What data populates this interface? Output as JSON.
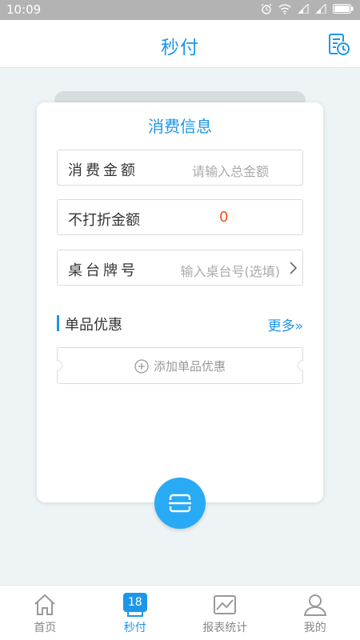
{
  "status_bar": {
    "time": "10:09",
    "icons": [
      "alarm-icon",
      "wifi-icon",
      "signal-icon",
      "signal-icon",
      "battery-icon"
    ]
  },
  "header": {
    "title": "秒付",
    "history_icon": "history-icon"
  },
  "card": {
    "title": "消费信息",
    "fields": {
      "amount": {
        "label": "消费金额",
        "placeholder": "请输入总金额"
      },
      "no_discount": {
        "label": "不打折金额",
        "value": "0"
      },
      "table": {
        "label": "桌台牌号",
        "placeholder": "输入桌台号(选填)"
      }
    },
    "section": {
      "title": "单品优惠",
      "more_label": "更多»"
    },
    "add_coupon_label": "添加单品优惠"
  },
  "scan_button": {
    "icon": "scan-icon"
  },
  "tabbar": {
    "tabs": [
      {
        "label": "首页",
        "icon": "home-icon",
        "active": false
      },
      {
        "label": "秒付",
        "icon": "calendar-badge-icon",
        "badge": "18",
        "active": true
      },
      {
        "label": "报表统计",
        "icon": "chart-icon",
        "active": false
      },
      {
        "label": "我的",
        "icon": "user-icon",
        "active": false
      }
    ]
  },
  "colors": {
    "accent": "#1d96e8",
    "scan_button": "#29aaf4",
    "zero_value": "#f4511e",
    "background": "#eef3f5"
  }
}
